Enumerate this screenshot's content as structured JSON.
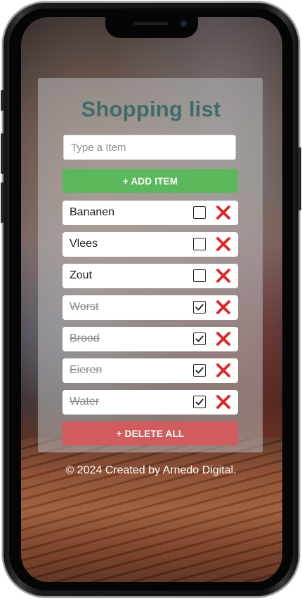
{
  "app": {
    "title": "Shopping list",
    "input_placeholder": "Type a Item",
    "add_button_label": "+ ADD ITEM",
    "delete_all_label": "+ DELETE ALL",
    "footer": "© 2024 Created by Arnedo Digital."
  },
  "items": [
    {
      "label": "Bananen",
      "checked": false
    },
    {
      "label": "Vlees",
      "checked": false
    },
    {
      "label": "Zout",
      "checked": false
    },
    {
      "label": "Worst",
      "checked": true
    },
    {
      "label": "Brood",
      "checked": true
    },
    {
      "label": "Eieren",
      "checked": true
    },
    {
      "label": "Water",
      "checked": true
    }
  ],
  "colors": {
    "title": "#3f6b6a",
    "add_button": "#5cb85c",
    "delete_all_button": "#d15b5d",
    "delete_icon": "#e02424"
  },
  "icons": {
    "checkbox_checked": "check-icon",
    "delete": "close-x-icon"
  }
}
